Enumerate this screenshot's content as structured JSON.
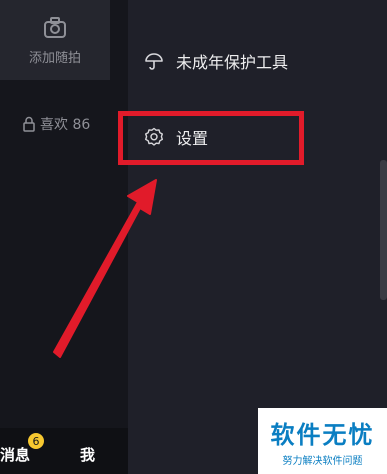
{
  "profile": {
    "add_moment_label": "添加随拍",
    "likes_label": "喜欢 86"
  },
  "bottom_tabs": {
    "messages_label": "消息",
    "messages_badge": "6",
    "me_label": "我"
  },
  "drawer": {
    "items": [
      {
        "label": "未成年保护工具",
        "icon": "umbrella-icon"
      },
      {
        "label": "设置",
        "icon": "gear-icon"
      }
    ]
  },
  "annotation": {
    "highlight_color": "#e11b2a",
    "arrow_color": "#e11b2a",
    "highlighted_item": "设置"
  },
  "watermark": {
    "title": "软件无忧",
    "subtitle": "努力解决软件问题"
  },
  "colors": {
    "background": "#1f2029",
    "badge": "#f7c830",
    "watermark_text": "#0a7ec2"
  }
}
